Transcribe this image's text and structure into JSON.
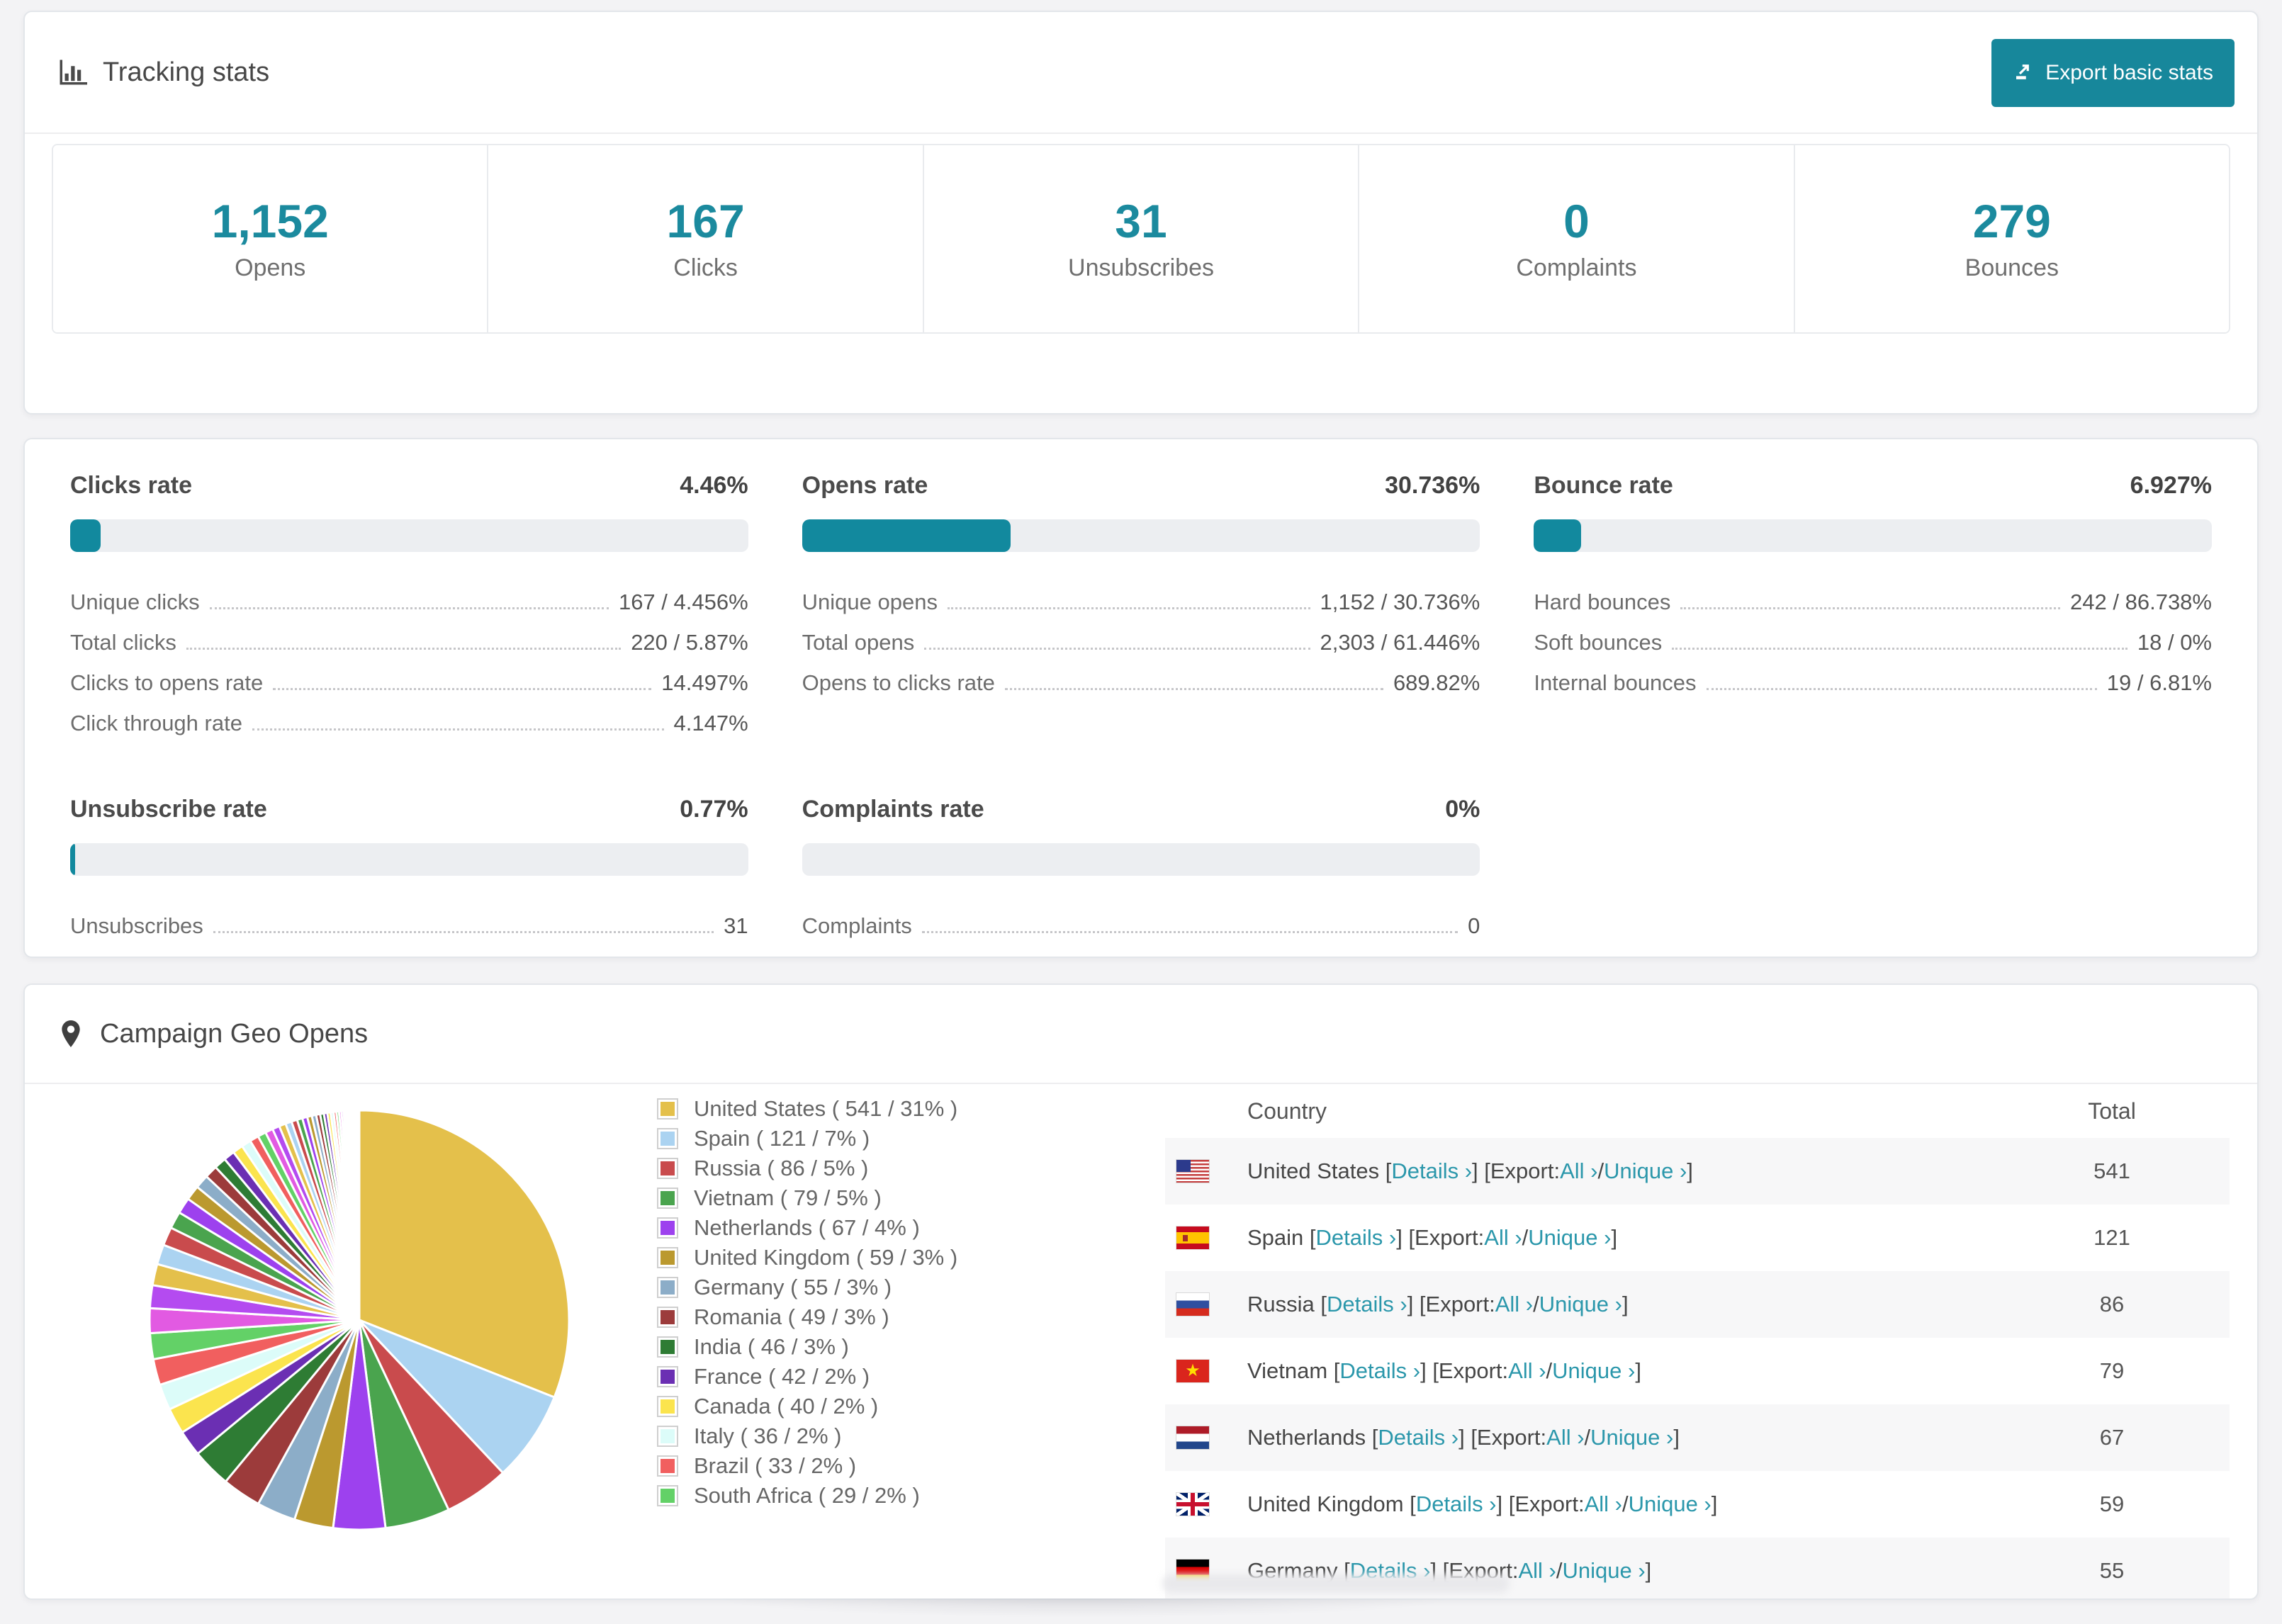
{
  "accent": "#1b8a9e",
  "tracking": {
    "title": "Tracking stats",
    "export_button": "Export basic stats",
    "stats": [
      {
        "value": "1,152",
        "label": "Opens"
      },
      {
        "value": "167",
        "label": "Clicks"
      },
      {
        "value": "31",
        "label": "Unsubscribes"
      },
      {
        "value": "0",
        "label": "Complaints"
      },
      {
        "value": "279",
        "label": "Bounces"
      }
    ]
  },
  "rates": [
    {
      "title": "Clicks rate",
      "value": "4.46%",
      "bar_percent": 4.46,
      "rows": [
        {
          "label": "Unique clicks",
          "value": "167 / 4.456%"
        },
        {
          "label": "Total clicks",
          "value": "220 / 5.87%"
        },
        {
          "label": "Clicks to opens rate",
          "value": "14.497%"
        },
        {
          "label": "Click through rate",
          "value": "4.147%"
        }
      ]
    },
    {
      "title": "Opens rate",
      "value": "30.736%",
      "bar_percent": 30.736,
      "rows": [
        {
          "label": "Unique opens",
          "value": "1,152 / 30.736%"
        },
        {
          "label": "Total opens",
          "value": "2,303 / 61.446%"
        },
        {
          "label": "Opens to clicks rate",
          "value": "689.82%"
        }
      ]
    },
    {
      "title": "Bounce rate",
      "value": "6.927%",
      "bar_percent": 6.927,
      "rows": [
        {
          "label": "Hard bounces",
          "value": "242 / 86.738%"
        },
        {
          "label": "Soft bounces",
          "value": "18 / 0%"
        },
        {
          "label": "Internal bounces",
          "value": "19 / 6.81%"
        }
      ]
    },
    {
      "title": "Unsubscribe rate",
      "value": "0.77%",
      "bar_percent": 0.77,
      "rows": [
        {
          "label": "Unsubscribes",
          "value": "31"
        }
      ]
    },
    {
      "title": "Complaints rate",
      "value": "0%",
      "bar_percent": 0,
      "rows": [
        {
          "label": "Complaints",
          "value": "0"
        }
      ]
    }
  ],
  "geo": {
    "title": "Campaign Geo Opens",
    "chart_data": {
      "type": "pie",
      "title": "Campaign Geo Opens",
      "start_angle_deg": -90,
      "direction": "clockwise",
      "legend_position": "right",
      "series": [
        {
          "name": "United States",
          "value": 541,
          "percent": 31,
          "color": "#e4c04b"
        },
        {
          "name": "Spain",
          "value": 121,
          "percent": 7,
          "color": "#abd3f1"
        },
        {
          "name": "Russia",
          "value": 86,
          "percent": 5,
          "color": "#c94b4d"
        },
        {
          "name": "Vietnam",
          "value": 79,
          "percent": 5,
          "color": "#4aa44e"
        },
        {
          "name": "Netherlands",
          "value": 67,
          "percent": 4,
          "color": "#9d41ee"
        },
        {
          "name": "United Kingdom",
          "value": 59,
          "percent": 3,
          "color": "#bb992f"
        },
        {
          "name": "Germany",
          "value": 55,
          "percent": 3,
          "color": "#8cadc8"
        },
        {
          "name": "Romania",
          "value": 49,
          "percent": 3,
          "color": "#9c3b3b"
        },
        {
          "name": "India",
          "value": 46,
          "percent": 3,
          "color": "#2e7c34"
        },
        {
          "name": "France",
          "value": 42,
          "percent": 2,
          "color": "#6b2fb3"
        },
        {
          "name": "Canada",
          "value": 40,
          "percent": 2,
          "color": "#fbe44e"
        },
        {
          "name": "Italy",
          "value": 36,
          "percent": 2,
          "color": "#dcfcf9"
        },
        {
          "name": "Brazil",
          "value": 33,
          "percent": 2,
          "color": "#f15f5f"
        },
        {
          "name": "South Africa",
          "value": 29,
          "percent": 2,
          "color": "#63d167"
        }
      ],
      "others_percent": 26,
      "extra_colors": [
        "#e25ae2",
        "#b44bf0"
      ]
    },
    "legend_format": {
      "open": " ( ",
      "sep": " / ",
      "close": "% )"
    },
    "table": {
      "columns": [
        "Country",
        "Total"
      ],
      "labels": {
        "lbracket": "[",
        "rbracket": "]",
        "details": "Details ›",
        "export": "Export:",
        "all": "All ›",
        "unique": "Unique ›",
        "slash": "/"
      },
      "rows": [
        {
          "country": "United States",
          "flag": "us",
          "total": "541"
        },
        {
          "country": "Spain",
          "flag": "es",
          "total": "121"
        },
        {
          "country": "Russia",
          "flag": "ru",
          "total": "86"
        },
        {
          "country": "Vietnam",
          "flag": "vn",
          "total": "79"
        },
        {
          "country": "Netherlands",
          "flag": "nl",
          "total": "67"
        },
        {
          "country": "United Kingdom",
          "flag": "gb",
          "total": "59"
        },
        {
          "country": "Germany",
          "flag": "de",
          "total": "55"
        }
      ]
    }
  }
}
